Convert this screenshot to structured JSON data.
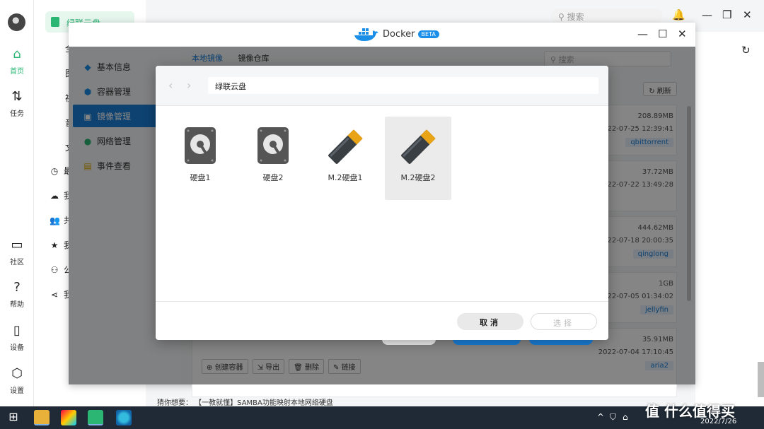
{
  "rail": {
    "items": [
      {
        "label": "首页",
        "icon": "home-icon"
      },
      {
        "label": "任务",
        "icon": "transfer-icon"
      },
      {
        "label": "社区",
        "icon": "chat-icon"
      },
      {
        "label": "帮助",
        "icon": "help-icon"
      },
      {
        "label": "设备",
        "icon": "device-icon"
      },
      {
        "label": "设置",
        "icon": "settings-icon"
      }
    ]
  },
  "side": {
    "brand": "绿联云盘",
    "rows": [
      "全",
      "图",
      "视",
      "音",
      "文",
      "最",
      "我",
      "共",
      "我",
      "公",
      "我"
    ]
  },
  "topbar": {
    "search_placeholder": "搜索"
  },
  "docker": {
    "title": "Docker",
    "beta": "BETA",
    "nav": [
      {
        "label": "基本信息"
      },
      {
        "label": "容器管理"
      },
      {
        "label": "镜像管理"
      },
      {
        "label": "网络管理"
      },
      {
        "label": "事件查看"
      }
    ],
    "tabs": [
      "本地镜像",
      "镜像仓库"
    ],
    "search_placeholder": "搜索",
    "refresh_label": "刷新",
    "images": [
      {
        "size": "208.89MB",
        "date": "2022-07-25 12:39:41",
        "tag": "qbittorrent"
      },
      {
        "size": "37.72MB",
        "date": "2022-07-22 13:49:28",
        "tag": ""
      },
      {
        "size": "444.62MB",
        "date": "2022-07-18 20:00:35",
        "tag": "qinglong"
      },
      {
        "size": "1GB",
        "date": "2022-07-05 01:34:02",
        "tag": "jellyfin"
      },
      {
        "size": "35.91MB",
        "date": "2022-07-04 17:10:45",
        "tag": "aria2"
      }
    ],
    "actions": [
      "创建容器",
      "导出",
      "删除",
      "链接"
    ]
  },
  "modal": {
    "path": "绿联云盘",
    "drives": [
      {
        "label": "硬盘1",
        "kind": "hdd"
      },
      {
        "label": "硬盘2",
        "kind": "hdd"
      },
      {
        "label": "M.2硬盘1",
        "kind": "ssd"
      },
      {
        "label": "M.2硬盘2",
        "kind": "ssd"
      }
    ],
    "selected_drive": "M.2硬盘2",
    "cancel_label": "取消",
    "choose_label": "选择"
  },
  "hint": "猜你想要：  【一教就懂】SAMBA功能映射本地网络硬盘",
  "taskbar": {
    "date": "2022/7/26"
  },
  "watermark": "值 什么值得买",
  "colors": {
    "accent_green": "#2bb673",
    "accent_blue": "#1b7fd9",
    "beta_blue": "#1b8fe8"
  }
}
